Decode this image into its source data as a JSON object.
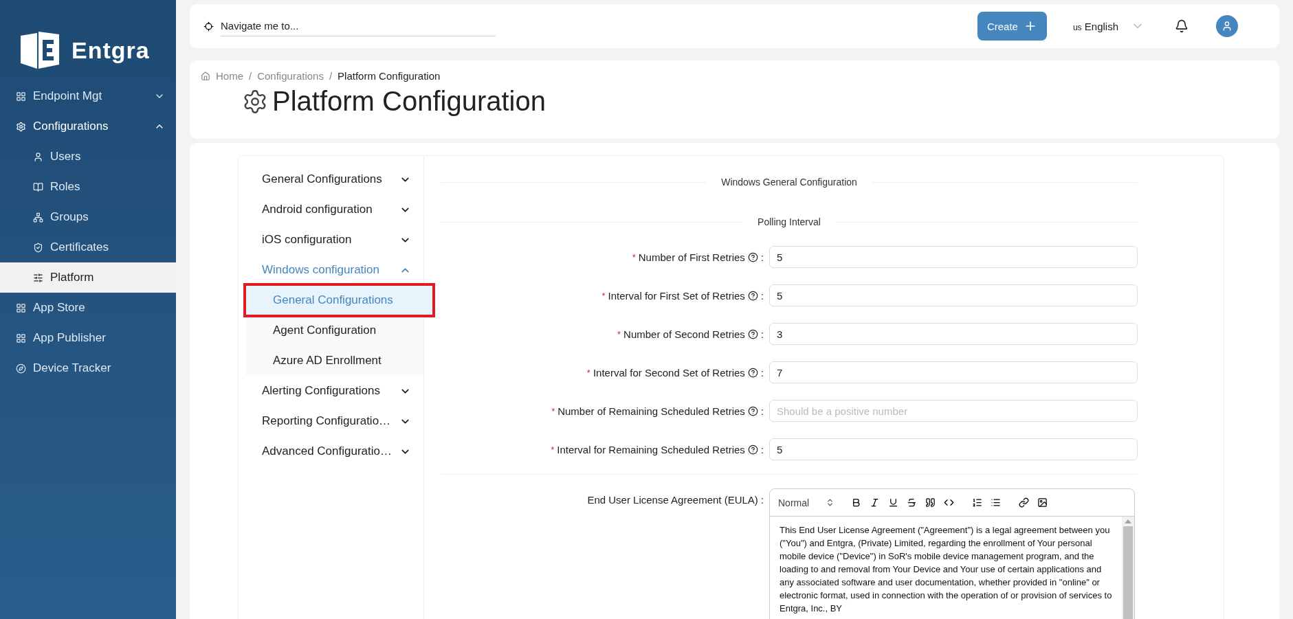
{
  "brand": {
    "name": "Entgra"
  },
  "sidebar": {
    "items": [
      {
        "label": "Endpoint Mgt",
        "expanded": false
      },
      {
        "label": "Configurations",
        "expanded": true,
        "children": [
          {
            "label": "Users",
            "selected": false
          },
          {
            "label": "Roles",
            "selected": false
          },
          {
            "label": "Groups",
            "selected": false
          },
          {
            "label": "Certificates",
            "selected": false
          },
          {
            "label": "Platform",
            "selected": true
          }
        ]
      },
      {
        "label": "App Store",
        "expanded": false
      },
      {
        "label": "App Publisher",
        "expanded": false
      },
      {
        "label": "Device Tracker",
        "expanded": false
      }
    ]
  },
  "header": {
    "search": {
      "value": "Navigate me to..."
    },
    "create_button": "Create",
    "language": {
      "flag": "us",
      "label": "English"
    }
  },
  "breadcrumb": {
    "separator": "/",
    "items": [
      "Home",
      "Configurations",
      "Platform Configuration"
    ]
  },
  "page_title": "Platform Configuration",
  "config_menu": [
    {
      "label": "General Configurations",
      "expanded": false
    },
    {
      "label": "Android configuration",
      "expanded": false
    },
    {
      "label": "iOS configuration",
      "expanded": false
    },
    {
      "label": "Windows configuration",
      "expanded": true,
      "children": [
        {
          "label": "General Configurations",
          "selected": true
        },
        {
          "label": "Agent Configuration",
          "selected": false
        },
        {
          "label": "Azure AD Enrollment",
          "selected": false
        }
      ]
    },
    {
      "label": "Alerting Configurations",
      "expanded": false
    },
    {
      "label": "Reporting Configuratio…",
      "expanded": false
    },
    {
      "label": "Advanced Configuratio…",
      "expanded": false
    }
  ],
  "form": {
    "section_title": "Windows General Configuration",
    "subsection_title": "Polling Interval",
    "required_mark": "*",
    "label_suffix": ":",
    "fields": [
      {
        "label": "Number of First Retries",
        "required": true,
        "value": "5"
      },
      {
        "label": "Interval for First Set of Retries",
        "required": true,
        "value": "5"
      },
      {
        "label": "Number of Second Retries",
        "required": true,
        "value": "3"
      },
      {
        "label": "Interval for Second Set of Retries",
        "required": true,
        "value": "7"
      },
      {
        "label": "Number of Remaining Scheduled Retries",
        "required": true,
        "placeholder": "Should be a positive number"
      },
      {
        "label": "Interval for Remaining Scheduled Retries",
        "required": true,
        "value": "5"
      }
    ],
    "eula": {
      "label": "End User License Agreement (EULA)",
      "format": "Normal",
      "text": "This End User License Agreement (\"Agreement\") is a legal agreement between you (\"You\") and Entgra, (Private) Limited, regarding the enrollment of Your personal mobile device (\"Device\") in SoR's mobile device management program, and the loading to and removal from Your Device and Your use of certain applications and any associated software and user documentation, whether provided in \"online\" or electronic format, used in connection with the operation of or provision of services to Entgra, Inc., BY"
    }
  }
}
